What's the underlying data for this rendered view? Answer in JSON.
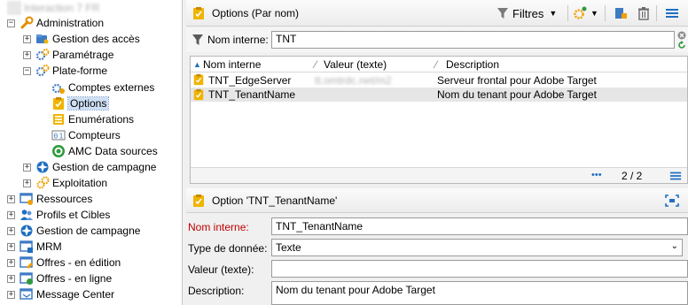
{
  "tree": {
    "root_label": "Interaction 7 FR",
    "administration": "Administration",
    "gestion_acces": "Gestion des accès",
    "parametrage": "Paramétrage",
    "plateforme": "Plate-forme",
    "comptes_externes": "Comptes externes",
    "options": "Options",
    "enumerations": "Enumérations",
    "compteurs": "Compteurs",
    "amc": "AMC Data sources",
    "gestion_campagne_admin": "Gestion de campagne",
    "exploitation": "Exploitation",
    "ressources": "Ressources",
    "profils": "Profils et Cibles",
    "gestion_campagne": "Gestion de campagne",
    "mrm": "MRM",
    "offres_edition": "Offres - en édition",
    "offres_ligne": "Offres - en ligne",
    "message_center": "Message Center"
  },
  "list_header": {
    "title": "Options (Par nom)",
    "filters_label": "Filtres"
  },
  "filter": {
    "label": "Nom interne:",
    "value": "TNT"
  },
  "grid": {
    "columns": [
      "Nom interne",
      "Valeur (texte)",
      "Description"
    ],
    "rows": [
      {
        "name": "TNT_EdgeServer",
        "value": "tt.omtrdc.net/m2",
        "description": "Serveur frontal pour Adobe Target"
      },
      {
        "name": "TNT_TenantName",
        "value": "",
        "description": "Nom du tenant pour Adobe Target"
      }
    ],
    "count": "2 / 2"
  },
  "detail": {
    "title": "Option 'TNT_TenantName'",
    "name_label": "Nom interne:",
    "name_value": "TNT_TenantName",
    "type_label": "Type de donnée:",
    "type_value": "Texte",
    "value_label": "Valeur (texte):",
    "value_value": "",
    "desc_label": "Description:",
    "desc_value": "Nom du tenant pour Adobe Target"
  },
  "colors": {
    "required_label": "#c00000",
    "selection": "#cfe0f5",
    "accent": "#1f6fbf"
  }
}
